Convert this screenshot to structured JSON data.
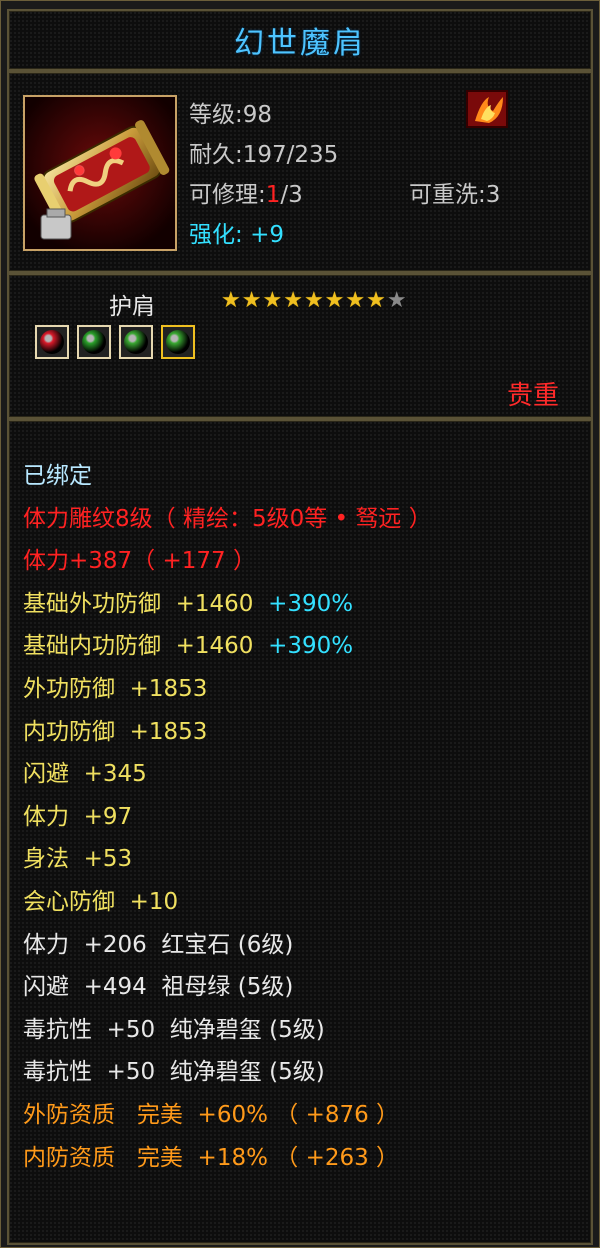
{
  "item": {
    "name": "幻世魔肩",
    "level_label": "等级",
    "level_value": "98",
    "durability_label": "耐久",
    "durability_value": "197/235",
    "repair_label": "可修理",
    "repair_current": "1",
    "repair_max": "/3",
    "rewash_label": "可重洗",
    "rewash_value": "3",
    "enhance_label": "强化",
    "enhance_value": "+9",
    "type": "护肩",
    "stars_total": 9,
    "stars_filled": 8,
    "rarity": "贵重",
    "gems": [
      {
        "name": "red-gem",
        "color": "#d81a2a"
      },
      {
        "name": "green-gem",
        "color": "#2aa02a"
      },
      {
        "name": "green-gem",
        "color": "#3aa832"
      },
      {
        "name": "green-gem",
        "color": "#3aa832"
      }
    ]
  },
  "attributes": [
    {
      "parts": [
        {
          "t": "已绑定",
          "c": "c-bound"
        }
      ]
    },
    {
      "parts": [
        {
          "t": "体力雕纹8级（ 精绘：5级0等 • 驽远 ）",
          "c": "c-red"
        }
      ]
    },
    {
      "parts": [
        {
          "t": "体力+387（ +177 ）",
          "c": "c-red"
        }
      ]
    },
    {
      "parts": [
        {
          "t": "基础外功防御  +1460  ",
          "c": "c-yellow"
        },
        {
          "t": "+390%",
          "c": "c-cyan"
        }
      ]
    },
    {
      "parts": [
        {
          "t": "基础内功防御  +1460  ",
          "c": "c-yellow"
        },
        {
          "t": "+390%",
          "c": "c-cyan"
        }
      ]
    },
    {
      "parts": [
        {
          "t": "外功防御  +1853",
          "c": "c-yellow"
        }
      ]
    },
    {
      "parts": [
        {
          "t": "内功防御  +1853",
          "c": "c-yellow"
        }
      ]
    },
    {
      "parts": [
        {
          "t": "闪避  +345",
          "c": "c-yellow"
        }
      ]
    },
    {
      "parts": [
        {
          "t": "体力  +97",
          "c": "c-yellow"
        }
      ]
    },
    {
      "parts": [
        {
          "t": "身法  +53",
          "c": "c-yellow"
        }
      ]
    },
    {
      "parts": [
        {
          "t": "会心防御  +10",
          "c": "c-yellow"
        }
      ]
    },
    {
      "parts": [
        {
          "t": "体力  +206  红宝石 (6级)",
          "c": "c-white"
        }
      ]
    },
    {
      "parts": [
        {
          "t": "闪避  +494  祖母绿 (5级)",
          "c": "c-white"
        }
      ]
    },
    {
      "parts": [
        {
          "t": "毒抗性  +50  纯净碧玺 (5级)",
          "c": "c-white"
        }
      ]
    },
    {
      "parts": [
        {
          "t": "毒抗性  +50  纯净碧玺 (5级)",
          "c": "c-white"
        }
      ]
    },
    {
      "parts": [
        {
          "t": "外防资质   完美  +60% （ +876 ）",
          "c": "c-orange"
        }
      ]
    },
    {
      "parts": [
        {
          "t": "内防资质   完美  +18% （ +263 ）",
          "c": "c-orange"
        }
      ]
    }
  ]
}
